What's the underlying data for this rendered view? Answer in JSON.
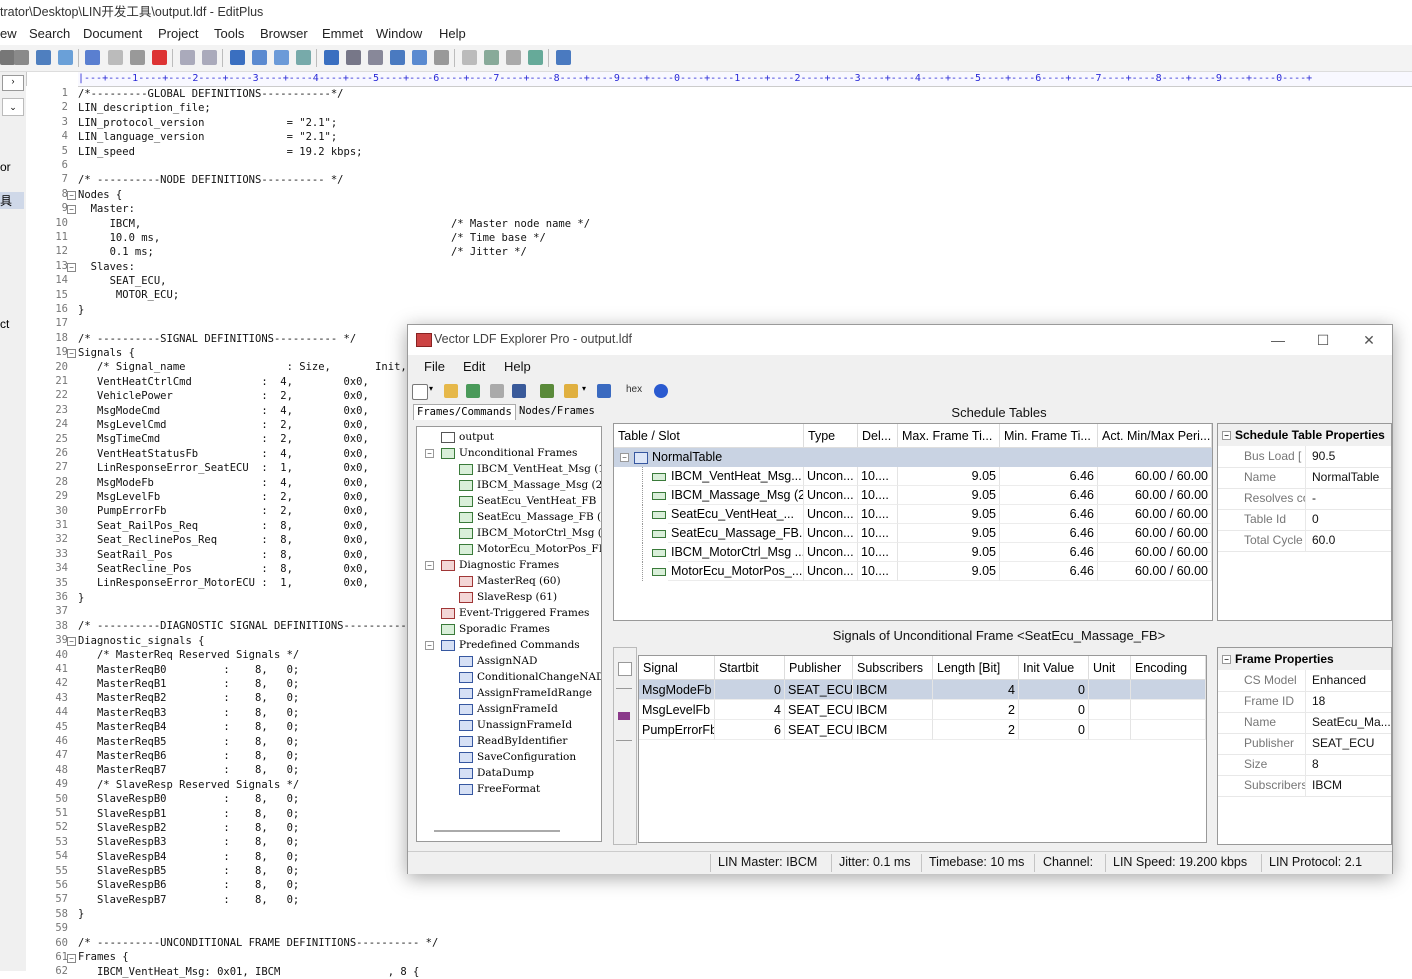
{
  "editplus": {
    "title": "trator\\Desktop\\LIN开发工具\\output.ldf - EditPlus",
    "menu": [
      "ew",
      "Search",
      "Document",
      "Project",
      "Tools",
      "Browser",
      "Emmet",
      "Window",
      "Help"
    ],
    "ruler": "|---+----1----+----2----+----3----+----4----+----5----+----6----+----7----+----8----+----9----+----0----+----1----+----2----+----3----+----4----+----5----+----6----+----7----+----8----+----9----+----0----+",
    "left_labels": [
      "or",
      "具",
      "ct"
    ],
    "line_numbers": [
      "1",
      "2",
      "3",
      "4",
      "5",
      "6",
      "7",
      "8",
      "9",
      "10",
      "11",
      "12",
      "13",
      "14",
      "15",
      "16",
      "17",
      "18",
      "19",
      "20",
      "21",
      "22",
      "23",
      "24",
      "25",
      "26",
      "27",
      "28",
      "29",
      "30",
      "31",
      "32",
      "33",
      "34",
      "35",
      "36",
      "37",
      "38",
      "39",
      "40",
      "41",
      "42",
      "43",
      "44",
      "45",
      "46",
      "47",
      "48",
      "49",
      "50",
      "51",
      "52",
      "53",
      "54",
      "55",
      "56",
      "57",
      "58",
      "59",
      "60",
      "61",
      "62"
    ],
    "code": [
      "/*---------GLOBAL DEFINITIONS-----------*/",
      "LIN_description_file;",
      "LIN_protocol_version             = \"2.1\";",
      "LIN_language_version             = \"2.1\";",
      "LIN_speed                        = 19.2 kbps;",
      "",
      "/* ----------NODE DEFINITIONS---------- */",
      "Nodes {",
      "  Master:",
      "     IBCM,                                                 /* Master node name */",
      "     10.0 ms,                                              /* Time base */",
      "     0.1 ms;                                               /* Jitter */",
      "  Slaves:",
      "     SEAT_ECU,",
      "      MOTOR_ECU;",
      "}",
      "",
      "/* ----------SIGNAL DEFINITIONS---------- */",
      "Signals {",
      "   /* Signal_name                : Size,       Init,",
      "   VentHeatCtrlCmd           :  4,        0x0,",
      "   VehiclePower              :  2,        0x0,",
      "   MsgModeCmd                :  4,        0x0,",
      "   MsgLevelCmd               :  2,        0x0,",
      "   MsgTimeCmd                :  2,        0x0,",
      "   VentHeatStatusFb          :  4,        0x0,",
      "   LinResponseError_SeatECU  :  1,        0x0,",
      "   MsgModeFb                 :  4,        0x0,",
      "   MsgLevelFb                :  2,        0x0,",
      "   PumpErrorFb               :  2,        0x0,",
      "   Seat_RailPos_Req          :  8,        0x0,",
      "   Seat_ReclinePos_Req       :  8,        0x0,",
      "   SeatRail_Pos              :  8,        0x0,",
      "   SeatRecline_Pos           :  8,        0x0,",
      "   LinResponseError_MotorECU :  1,        0x0,",
      "}",
      "",
      "/* ----------DIAGNOSTIC SIGNAL DEFINITIONS----------",
      "Diagnostic_signals {",
      "   /* MasterReq Reserved Signals */",
      "   MasterReqB0         :    8,   0;",
      "   MasterReqB1         :    8,   0;",
      "   MasterReqB2         :    8,   0;",
      "   MasterReqB3         :    8,   0;",
      "   MasterReqB4         :    8,   0;",
      "   MasterReqB5         :    8,   0;",
      "   MasterReqB6         :    8,   0;",
      "   MasterReqB7         :    8,   0;",
      "   /* SlaveResp Reserved Signals */",
      "   SlaveRespB0         :    8,   0;",
      "   SlaveRespB1         :    8,   0;",
      "   SlaveRespB2         :    8,   0;",
      "   SlaveRespB3         :    8,   0;",
      "   SlaveRespB4         :    8,   0;",
      "   SlaveRespB5         :    8,   0;",
      "   SlaveRespB6         :    8,   0;",
      "   SlaveRespB7         :    8,   0;",
      "}",
      "",
      "/* ----------UNCONDITIONAL FRAME DEFINITIONS---------- */",
      "Frames {",
      "   IBCM_VentHeat_Msg: 0x01, IBCM                 , 8 {"
    ]
  },
  "ldf": {
    "window_title": "Vector LDF Explorer Pro - output.ldf",
    "window_buttons": [
      "—",
      "☐",
      "✕"
    ],
    "menu": [
      "File",
      "Edit",
      "Help"
    ],
    "toolbar_hex": "hex",
    "tabs": [
      "Frames/Commands",
      "Nodes/Frames"
    ],
    "tree": [
      {
        "label": "output",
        "level": 0,
        "icon": "net"
      },
      {
        "label": "Unconditional Frames",
        "level": 1,
        "icon": "green"
      },
      {
        "label": "IBCM_VentHeat_Msg (1",
        "level": 2,
        "icon": "green"
      },
      {
        "label": "IBCM_Massage_Msg (2)",
        "level": 2,
        "icon": "green"
      },
      {
        "label": "SeatEcu_VentHeat_FB",
        "level": 2,
        "icon": "green"
      },
      {
        "label": "SeatEcu_Massage_FB (",
        "level": 2,
        "icon": "green"
      },
      {
        "label": "IBCM_MotorCtrl_Msg (",
        "level": 2,
        "icon": "green"
      },
      {
        "label": "MotorEcu_MotorPos_FB",
        "level": 2,
        "icon": "green"
      },
      {
        "label": "Diagnostic Frames",
        "level": 1,
        "icon": "red"
      },
      {
        "label": "MasterReq (60)",
        "level": 2,
        "icon": "red"
      },
      {
        "label": "SlaveResp (61)",
        "level": 2,
        "icon": "red"
      },
      {
        "label": "Event-Triggered Frames",
        "level": 1,
        "icon": "red"
      },
      {
        "label": "Sporadic Frames",
        "level": 1,
        "icon": "green"
      },
      {
        "label": "Predefined Commands",
        "level": 1,
        "icon": "blue"
      },
      {
        "label": "AssignNAD",
        "level": 2,
        "icon": "blue"
      },
      {
        "label": "ConditionalChangeNAD",
        "level": 2,
        "icon": "blue"
      },
      {
        "label": "AssignFrameIdRange",
        "level": 2,
        "icon": "blue"
      },
      {
        "label": "AssignFrameId",
        "level": 2,
        "icon": "blue"
      },
      {
        "label": "UnassignFrameId",
        "level": 2,
        "icon": "blue"
      },
      {
        "label": "ReadByIdentifier",
        "level": 2,
        "icon": "blue"
      },
      {
        "label": "SaveConfiguration",
        "level": 2,
        "icon": "blue"
      },
      {
        "label": "DataDump",
        "level": 2,
        "icon": "blue"
      },
      {
        "label": "FreeFormat",
        "level": 2,
        "icon": "blue"
      }
    ],
    "schedule": {
      "title": "Schedule Tables",
      "columns": [
        "Table / Slot",
        "Type",
        "Del...",
        "Max. Frame Ti...",
        "Min. Frame Ti...",
        "Act. Min/Max Peri..."
      ],
      "table_name": "NormalTable",
      "rows": [
        [
          "IBCM_VentHeat_Msg...",
          "Uncon...",
          "10....",
          "9.05",
          "6.46",
          "60.00 / 60.00"
        ],
        [
          "IBCM_Massage_Msg (2)",
          "Uncon...",
          "10....",
          "9.05",
          "6.46",
          "60.00 / 60.00"
        ],
        [
          "SeatEcu_VentHeat_...",
          "Uncon...",
          "10....",
          "9.05",
          "6.46",
          "60.00 / 60.00"
        ],
        [
          "SeatEcu_Massage_FB...",
          "Uncon...",
          "10....",
          "9.05",
          "6.46",
          "60.00 / 60.00"
        ],
        [
          "IBCM_MotorCtrl_Msg ...",
          "Uncon...",
          "10....",
          "9.05",
          "6.46",
          "60.00 / 60.00"
        ],
        [
          "MotorEcu_MotorPos_...",
          "Uncon...",
          "10....",
          "9.05",
          "6.46",
          "60.00 / 60.00"
        ]
      ]
    },
    "schedule_props": {
      "title": "Schedule Table Properties",
      "rows": [
        [
          "Bus Load [",
          "90.5"
        ],
        [
          "Name",
          "NormalTable"
        ],
        [
          "Resolves co",
          "-"
        ],
        [
          "Table Id",
          "0"
        ],
        [
          "Total Cycle",
          "60.0"
        ]
      ]
    },
    "signals": {
      "title": "Signals of Unconditional Frame <SeatEcu_Massage_FB>",
      "columns": [
        "Signal",
        "Startbit",
        "Publisher",
        "Subscribers",
        "Length [Bit]",
        "Init Value",
        "Unit",
        "Encoding"
      ],
      "rows": [
        [
          "MsgModeFb",
          "0",
          "SEAT_ECU",
          "IBCM",
          "4",
          "0",
          "",
          ""
        ],
        [
          "MsgLevelFb",
          "4",
          "SEAT_ECU",
          "IBCM",
          "2",
          "0",
          "",
          ""
        ],
        [
          "PumpErrorFb",
          "6",
          "SEAT_ECU",
          "IBCM",
          "2",
          "0",
          "",
          ""
        ]
      ]
    },
    "frame_props": {
      "title": "Frame Properties",
      "rows": [
        [
          "CS Model",
          "Enhanced"
        ],
        [
          "Frame ID",
          "18"
        ],
        [
          "Name",
          "SeatEcu_Ma..."
        ],
        [
          "Publisher",
          "SEAT_ECU"
        ],
        [
          "Size",
          "8"
        ],
        [
          "Subscribers",
          "IBCM"
        ]
      ]
    },
    "status": [
      "LIN Master: IBCM",
      "Jitter: 0.1 ms",
      "Timebase: 10 ms",
      "Channel:",
      "LIN Speed: 19.200 kbps",
      "LIN Protocol: 2.1"
    ]
  },
  "colors": {
    "selection": "#c9d3e3",
    "accent": "#3657a0"
  }
}
